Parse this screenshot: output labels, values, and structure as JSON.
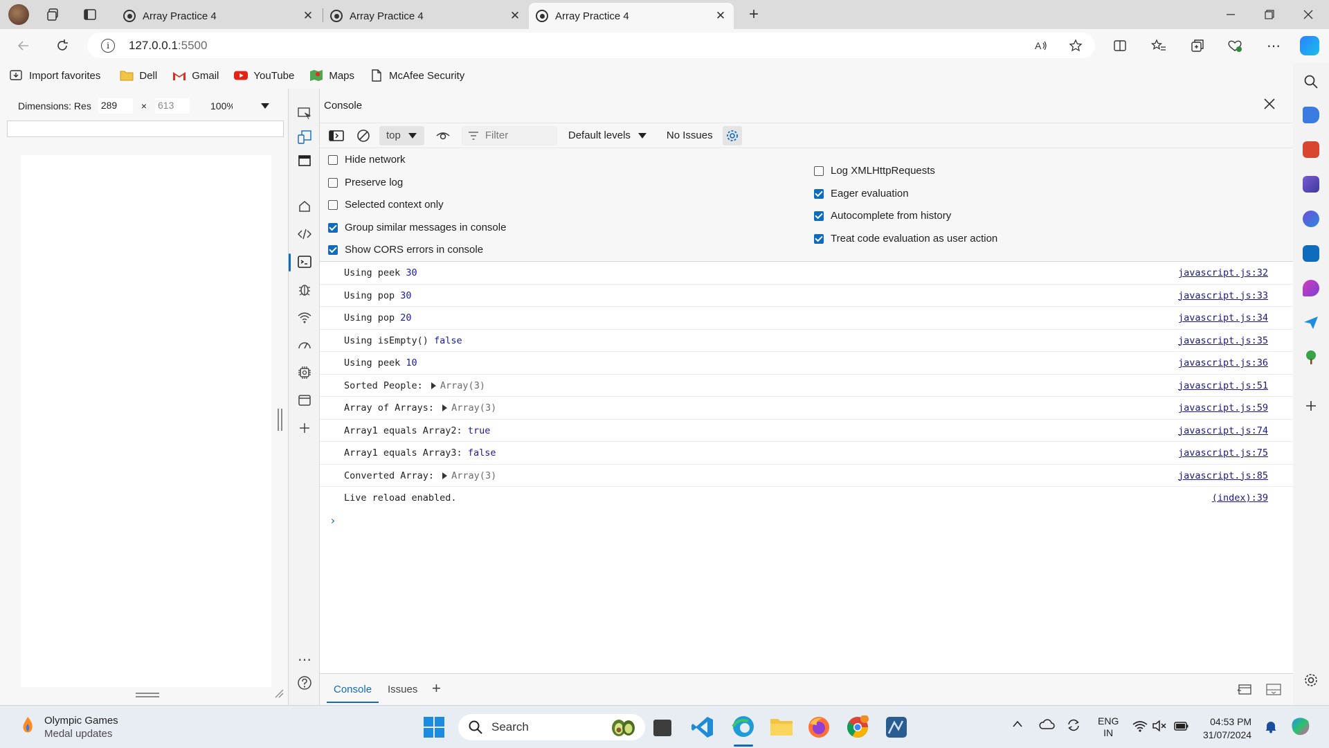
{
  "browser": {
    "tabs": [
      {
        "title": "Array Practice 4",
        "active": false
      },
      {
        "title": "Array Practice 4",
        "active": false
      },
      {
        "title": "Array Practice 4",
        "active": true
      }
    ],
    "new_tab": "+",
    "close_glyph": "✕",
    "address": {
      "host": "127.0.0.1",
      "port": ":5500"
    },
    "favorites": [
      {
        "label": "Import favorites",
        "icon": "import-icon"
      },
      {
        "label": "Dell",
        "icon": "folder-icon"
      },
      {
        "label": "Gmail",
        "icon": "gmail-icon"
      },
      {
        "label": "YouTube",
        "icon": "youtube-icon"
      },
      {
        "label": "Maps",
        "icon": "maps-icon"
      },
      {
        "label": "McAfee Security",
        "icon": "document-icon"
      }
    ]
  },
  "device": {
    "dimensions_label": "Dimensions: Res",
    "width": "289",
    "times": "×",
    "height": "613",
    "zoom": "100%"
  },
  "console": {
    "title": "Console",
    "context": "top",
    "filter_placeholder": "Filter",
    "levels": "Default levels",
    "issues": "No Issues",
    "settings_left": [
      {
        "label": "Hide network",
        "checked": false
      },
      {
        "label": "Preserve log",
        "checked": false
      },
      {
        "label": "Selected context only",
        "checked": false
      },
      {
        "label": "Group similar messages in console",
        "checked": true
      },
      {
        "label": "Show CORS errors in console",
        "checked": true
      }
    ],
    "settings_right": [
      {
        "label": "Log XMLHttpRequests",
        "checked": false
      },
      {
        "label": "Eager evaluation",
        "checked": true
      },
      {
        "label": "Autocomplete from history",
        "checked": true
      },
      {
        "label": "Treat code evaluation as user action",
        "checked": true
      }
    ],
    "messages": [
      {
        "text": "Using peek ",
        "value": "30",
        "kind": "num",
        "source": "javascript.js:32"
      },
      {
        "text": "Using pop ",
        "value": "30",
        "kind": "num",
        "source": "javascript.js:33"
      },
      {
        "text": "Using pop ",
        "value": "20",
        "kind": "num",
        "source": "javascript.js:34"
      },
      {
        "text": "Using isEmpty() ",
        "value": "false",
        "kind": "bool",
        "source": "javascript.js:35"
      },
      {
        "text": "Using peek ",
        "value": "10",
        "kind": "num",
        "source": "javascript.js:36"
      },
      {
        "text": "Sorted People: ",
        "value": "Array(3)",
        "kind": "array",
        "source": "javascript.js:51"
      },
      {
        "text": "Array of Arrays: ",
        "value": "Array(3)",
        "kind": "array",
        "source": "javascript.js:59"
      },
      {
        "text": "Array1 equals Array2: ",
        "value": "true",
        "kind": "bool",
        "source": "javascript.js:74"
      },
      {
        "text": "Array1 equals Array3: ",
        "value": "false",
        "kind": "bool",
        "source": "javascript.js:75"
      },
      {
        "text": "Converted Array: ",
        "value": "Array(3)",
        "kind": "array",
        "source": "javascript.js:85"
      },
      {
        "text": "Live reload enabled.",
        "value": "",
        "kind": "none",
        "source": "(index):39"
      }
    ],
    "prompt": "›",
    "drawer_tabs": [
      "Console",
      "Issues"
    ],
    "drawer_add": "+"
  },
  "taskbar": {
    "news_title": "Olympic Games",
    "news_subtitle": "Medal updates",
    "search_label": "Search",
    "lang_line1": "ENG",
    "lang_line2": "IN",
    "time": "04:53 PM",
    "date": "31/07/2024"
  },
  "colors": {
    "accent": "#0f6cbd",
    "value_blue": "#1a1aa6",
    "source_link": "#1a1a80"
  }
}
